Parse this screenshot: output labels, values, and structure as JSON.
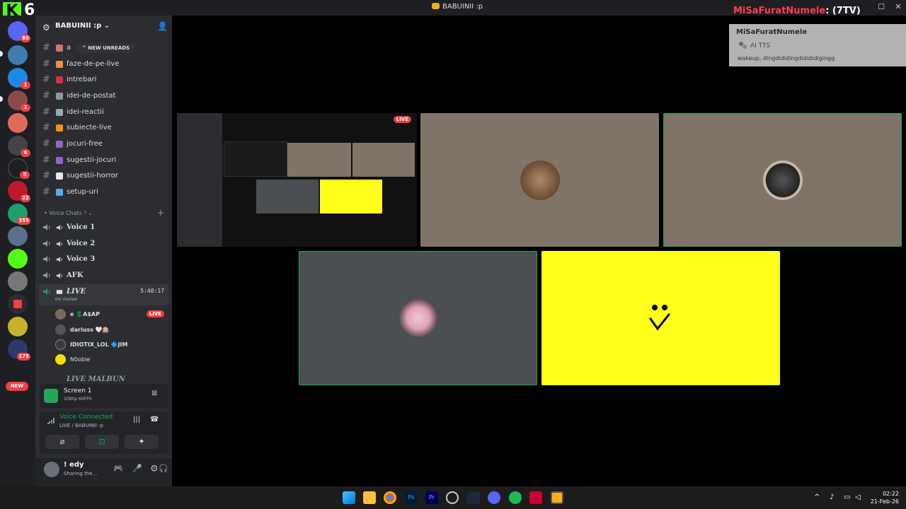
{
  "window": {
    "title": "BABUINII :p",
    "minimize": "—",
    "maximize": "☐",
    "close": "✕"
  },
  "kick": {
    "logo_letter": "K",
    "viewer_count": "6"
  },
  "stream_overlay": {
    "user": "MiSaFuratNumele",
    "suffix": ": (7TV)"
  },
  "servers": {
    "badges": [
      "80",
      "1",
      "1",
      "6",
      "5",
      "22",
      "355",
      "175"
    ],
    "new_label": "NEW"
  },
  "guild": {
    "name": "BABUINII :p ⌄"
  },
  "new_unreads": "^ NEW UNREADS",
  "text_channels": [
    {
      "name": "a",
      "emoji_color": "#d4746a"
    },
    {
      "name": "faze-de-pe-live",
      "emoji_color": "#f0913a"
    },
    {
      "name": "intrebari",
      "emoji_color": "#dd2e44"
    },
    {
      "name": "idei-de-postat",
      "emoji_color": "#8899a6"
    },
    {
      "name": "idei-reactii",
      "emoji_color": "#99aab5"
    },
    {
      "name": "subiecte-live",
      "emoji_color": "#f4900c"
    },
    {
      "name": "jocuri-free",
      "emoji_color": "#9266cc"
    },
    {
      "name": "sugestii-jocuri",
      "emoji_color": "#9266cc"
    },
    {
      "name": "sugestii-horror",
      "emoji_color": "#e6e7e8"
    },
    {
      "name": "setup-uri",
      "emoji_color": "#55acee"
    }
  ],
  "voice_category": "• Voice Chats ⁹ ⌄",
  "voice_channels": [
    "Voice 1",
    "Voice 2",
    "Voice 3",
    "AFK"
  ],
  "live_channel": {
    "name": "LIVE",
    "timer": "5:40:17",
    "status": "mc muisor"
  },
  "live_members": [
    {
      "name": "e  💲A$AP",
      "live": "LIVE",
      "color": "#7a6a5a"
    },
    {
      "name": "dariuss 🤍🎰",
      "live": "",
      "color": "#555"
    },
    {
      "name": "IDIOTIX_LOL  🔷JIM",
      "live": "",
      "color": "#3a3a3a"
    },
    {
      "name": "N0obie",
      "live": "",
      "color": "#f5e000"
    }
  ],
  "next_channel": "LIVE MALBUN",
  "screen_share": {
    "title": "Screen 1",
    "quality": "1080p 60FPS"
  },
  "voice": {
    "status": "Voice Connected",
    "location": "LIVE / BABUINII :p"
  },
  "user": {
    "name": "! edy",
    "status": "Sharing the..."
  },
  "chat": {
    "user": "MiSaFuratNumele",
    "bot": "AI TTS",
    "message": "wakeup, dingdididingdidididigingg"
  },
  "stream_tiles": {
    "live_tag": "LIVE"
  },
  "clock": {
    "time": "02:22",
    "date": "21-Feb-26"
  },
  "colors": {
    "accent_green": "#23a55a",
    "live_red": "#f23f43",
    "tile_brown": "#7f7467",
    "tile_gray": "#4b4e52",
    "tile_yellow": "#ffff1a"
  }
}
